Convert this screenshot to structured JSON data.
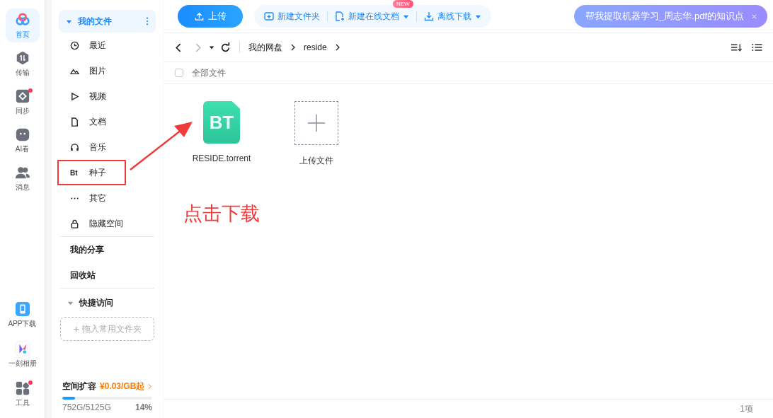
{
  "rail": {
    "top": [
      {
        "label": "首页",
        "selected": true,
        "badge": false
      },
      {
        "label": "传输",
        "selected": false,
        "badge": false
      },
      {
        "label": "同步",
        "selected": false,
        "badge": true
      },
      {
        "label": "AI看",
        "selected": false,
        "badge": false
      },
      {
        "label": "消息",
        "selected": false,
        "badge": false
      }
    ],
    "bottom": [
      {
        "label": "APP下载",
        "badge": false
      },
      {
        "label": "一刻相册",
        "badge": false
      },
      {
        "label": "工具",
        "badge": true
      }
    ]
  },
  "sidebar": {
    "my_files": {
      "label": "我的文件",
      "expanded": true,
      "selected": true
    },
    "items": [
      {
        "label": "最近",
        "annotated": false
      },
      {
        "label": "图片",
        "annotated": false
      },
      {
        "label": "视频",
        "annotated": false
      },
      {
        "label": "文档",
        "annotated": false
      },
      {
        "label": "音乐",
        "annotated": false
      },
      {
        "label": "种子",
        "icon_text": "Bt",
        "annotated": true
      },
      {
        "label": "其它",
        "annotated": false
      },
      {
        "label": "隐藏空间",
        "annotated": false
      }
    ],
    "links": [
      "我的分享",
      "回收站"
    ],
    "quick_access": {
      "label": "快捷访问",
      "expanded": true,
      "drop_hint": "拖入常用文件夹"
    },
    "storage": {
      "label": "空间扩容",
      "offer": "¥0.03/GB起",
      "level": 0.14,
      "usage": "752G/5125G",
      "percent": "14%"
    }
  },
  "toolbar": {
    "upload": "上传",
    "actions": [
      {
        "label": "新建文件夹",
        "dropdown": false
      },
      {
        "label": "新建在线文档",
        "dropdown": true,
        "badge": "NEW"
      },
      {
        "label": "离线下载",
        "dropdown": true
      }
    ],
    "ai_prompt": "帮我提取机器学习_周志华.pdf的知识点"
  },
  "nav": {
    "back_disabled": false,
    "forward_disabled": true,
    "breadcrumb": [
      "我的网盘",
      "reside"
    ]
  },
  "list_header": {
    "select_all": {
      "label": "全部文件",
      "checked": false
    }
  },
  "files": [
    {
      "kind": "torrent",
      "name": "RESIDE.torrent",
      "icon_text": "BT"
    },
    {
      "kind": "upload",
      "name": "上传文件"
    }
  ],
  "annotation": {
    "text": "点击下载"
  },
  "status_bar": {
    "count": "1项"
  }
}
